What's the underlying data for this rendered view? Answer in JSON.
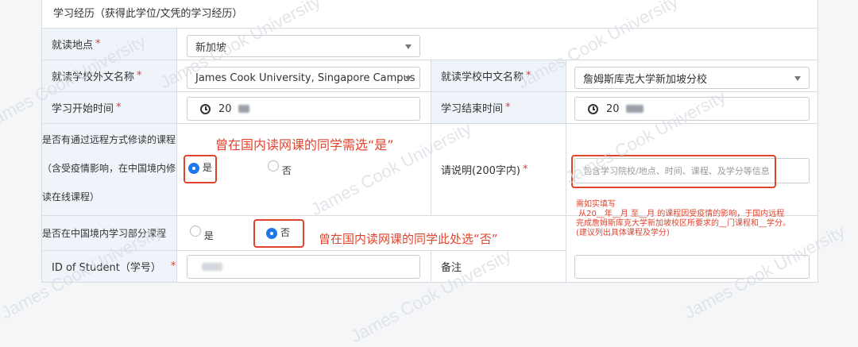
{
  "section_title": "学习经历（获得此学位/文凭的学习经历）",
  "rows": {
    "location_label": "就读地点",
    "location_value": "新加坡",
    "school_en_label": "就读学校外文名称",
    "school_en_value": "James Cook University, Singapore Campus",
    "school_cn_label": "就读学校中文名称",
    "school_cn_value": "詹姆斯库克大学新加坡分校",
    "start_label": "学习开始时间",
    "start_value": "20",
    "end_label": "学习结束时间",
    "end_value": "20",
    "remote_label_line1": "是否有通过远程方式修读的课程",
    "remote_label_line2": "（含受疫情影响，在中国境内修",
    "remote_label_line3": "读在线课程）",
    "remote_yes": "是",
    "remote_no": "否",
    "explain_label": "请说明(200字内)",
    "explain_placeholder": "包含学习院校/地点、时间、课程、及学分等信息",
    "explain_hint": "需如实填写\n 从20__年__月 至__月 的课程因受疫情的影响，于国内远程\n完成詹姆斯库克大学新加坡校区所要求的__门课程和__学分。\n(建议列出具体课程及学分)",
    "china_label": "是否在中国境内学习部分课程",
    "china_yes": "是",
    "china_no": "否",
    "student_id_label": "ID of Student（学号）",
    "remark_label": "备注"
  },
  "annotations": {
    "note1": "曾在国内读网课的同学需选“是”",
    "note2": "曾在国内读网课的同学此处选“否”"
  },
  "required_marker": "*",
  "watermark_text": "James Cook University",
  "colors": {
    "accent": "#1e78e8",
    "annotation": "#e0442f",
    "label_bg": "#eef4fa",
    "required": "#e23b3b"
  }
}
